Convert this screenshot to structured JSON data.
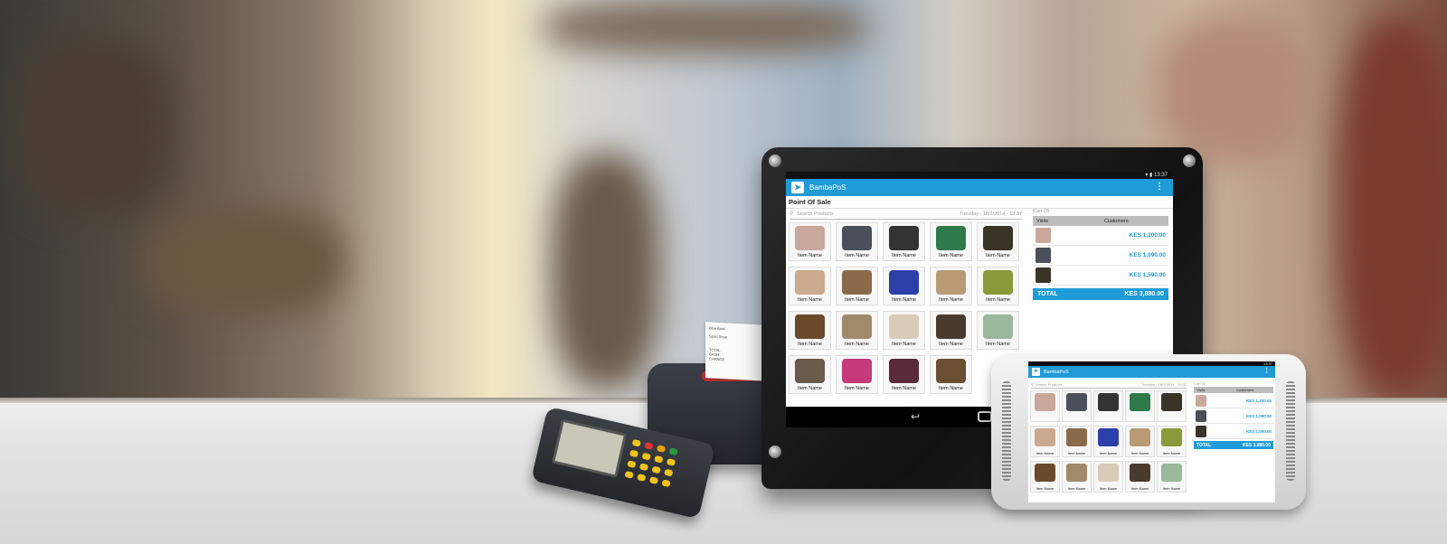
{
  "tablet": {
    "status_time": "13:37",
    "app_name": "BambaPoS",
    "page_title": "Point Of Sale",
    "search_placeholder": "Search Products",
    "date": "Tuesday - 18/2/2014 - 13:37",
    "products": [
      {
        "label": "Item Name",
        "color": "#c9a79b"
      },
      {
        "label": "Item Name",
        "color": "#4a4f5a"
      },
      {
        "label": "Item Name",
        "color": "#333333"
      },
      {
        "label": "Item Name",
        "color": "#2f7a4a"
      },
      {
        "label": "Item Name",
        "color": "#3a3328"
      },
      {
        "label": "Item Name",
        "color": "#caa98d"
      },
      {
        "label": "Item Name",
        "color": "#8a6a4a"
      },
      {
        "label": "Item Name",
        "color": "#2c3fa8"
      },
      {
        "label": "Item Name",
        "color": "#b99a74"
      },
      {
        "label": "Item Name",
        "color": "#8a9a3a"
      },
      {
        "label": "Item Name",
        "color": "#6b4a2c"
      },
      {
        "label": "Item Name",
        "color": "#a08a6a"
      },
      {
        "label": "Item Name",
        "color": "#d8ccb8"
      },
      {
        "label": "Item Name",
        "color": "#4a3a2c"
      },
      {
        "label": "Item Name",
        "color": "#9ab89a"
      },
      {
        "label": "Item Name",
        "color": "#6a5a4a"
      },
      {
        "label": "Item Name",
        "color": "#c43a7a"
      },
      {
        "label": "Item Name",
        "color": "#5a2a3a"
      },
      {
        "label": "Item Name",
        "color": "#6a5030"
      }
    ],
    "cart": {
      "title": "Cart (3)",
      "col_visits": "Visits",
      "col_customers": "Customers",
      "items": [
        {
          "amount": "KES 1,200.00",
          "color": "#c9a79b"
        },
        {
          "amount": "KES 1,090.00",
          "color": "#4a4f5a"
        },
        {
          "amount": "KES 1,590.00",
          "color": "#3a3328"
        }
      ],
      "total_label": "TOTAL",
      "total_value": "KES 3,880.00"
    }
  },
  "phone": {
    "status_time": "13:37",
    "app_name": "BambaPoS",
    "search_placeholder": "Search Products",
    "date": "Tuesday - 18/2/2014 - 13:37",
    "products": [
      {
        "label": "",
        "color": "#c9a79b"
      },
      {
        "label": "",
        "color": "#4a4f5a"
      },
      {
        "label": "",
        "color": "#333333"
      },
      {
        "label": "",
        "color": "#2f7a4a"
      },
      {
        "label": "",
        "color": "#3a3328"
      },
      {
        "label": "Item Name",
        "color": "#caa98d"
      },
      {
        "label": "Item Name",
        "color": "#8a6a4a"
      },
      {
        "label": "Item Name",
        "color": "#2c3fa8"
      },
      {
        "label": "Item Name",
        "color": "#b99a74"
      },
      {
        "label": "Item Name",
        "color": "#8a9a3a"
      },
      {
        "label": "Item Name",
        "color": "#6b4a2c"
      },
      {
        "label": "Item Name",
        "color": "#a08a6a"
      },
      {
        "label": "Item Name",
        "color": "#d8ccb8"
      },
      {
        "label": "Item Name",
        "color": "#4a3a2c"
      },
      {
        "label": "Item Name",
        "color": "#9ab89a"
      }
    ],
    "cart": {
      "title": "Cart (3)",
      "col_visits": "Visits",
      "col_customers": "Customers",
      "items": [
        {
          "amount": "KES 1,200.00",
          "color": "#c9a79b"
        },
        {
          "amount": "KES 1,090.00",
          "color": "#4a4f5a"
        },
        {
          "amount": "KES 1,090.00",
          "color": "#3a3328"
        }
      ],
      "total_label": "TOTAL",
      "total_value": "KES 3,880.00"
    }
  },
  "receipt": {
    "lines": [
      "Blue Bowl",
      "Sport Shoe",
      "TOTAL",
      "CASH",
      "CHANGE"
    ]
  },
  "colors": {
    "accent": "#1f9bd7"
  }
}
